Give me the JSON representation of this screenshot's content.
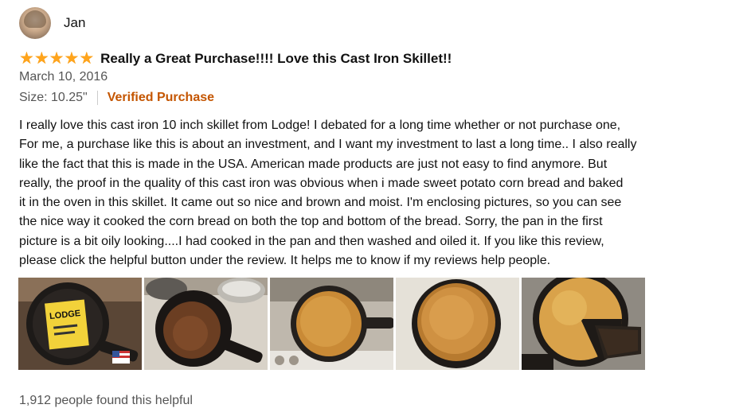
{
  "reviewer": {
    "name": "Jan",
    "avatar_icon": "profile-photo"
  },
  "review": {
    "rating": 5,
    "rating_max": 5,
    "title": "Really a Great Purchase!!!! Love this Cast Iron Skillet!!",
    "date": "March 10, 2016",
    "size": "Size: 10.25\"",
    "verified": "Verified Purchase",
    "body_lines": [
      "I really love this cast iron 10 inch skillet from Lodge! I debated for a long time whether or not purchase one,",
      "For me, a purchase like this is about an investment, and I want my investment to last a long time.. I also really",
      "like the fact that this is made in the USA. American made products are just not easy to find anymore. But",
      "really, the proof in the quality of this cast iron was obvious when i made sweet potato corn bread and baked",
      "it in the oven in this skillet. It came out so nice and brown and moist. I'm enclosing pictures, so you can see",
      "the nice way it cooked the corn bread on both the top and bottom of the bread. Sorry, the pan in the first",
      "picture is a bit oily looking....I had cooked in the pan and then washed and oiled it. If you like this review,",
      "please click the helpful button under the review. It helps me to know if my reviews help people."
    ],
    "images": [
      {
        "name": "review-image-skillet-label",
        "label_text": "LODGE"
      },
      {
        "name": "review-image-skillet-empty"
      },
      {
        "name": "review-image-cornbread-oven"
      },
      {
        "name": "review-image-cornbread-top"
      },
      {
        "name": "review-image-cornbread-sliced"
      }
    ],
    "helpful_text": "1,912 people found this helpful"
  },
  "colors": {
    "star": "#ffa41c",
    "verified": "#c45500",
    "secondary_text": "#555555"
  }
}
